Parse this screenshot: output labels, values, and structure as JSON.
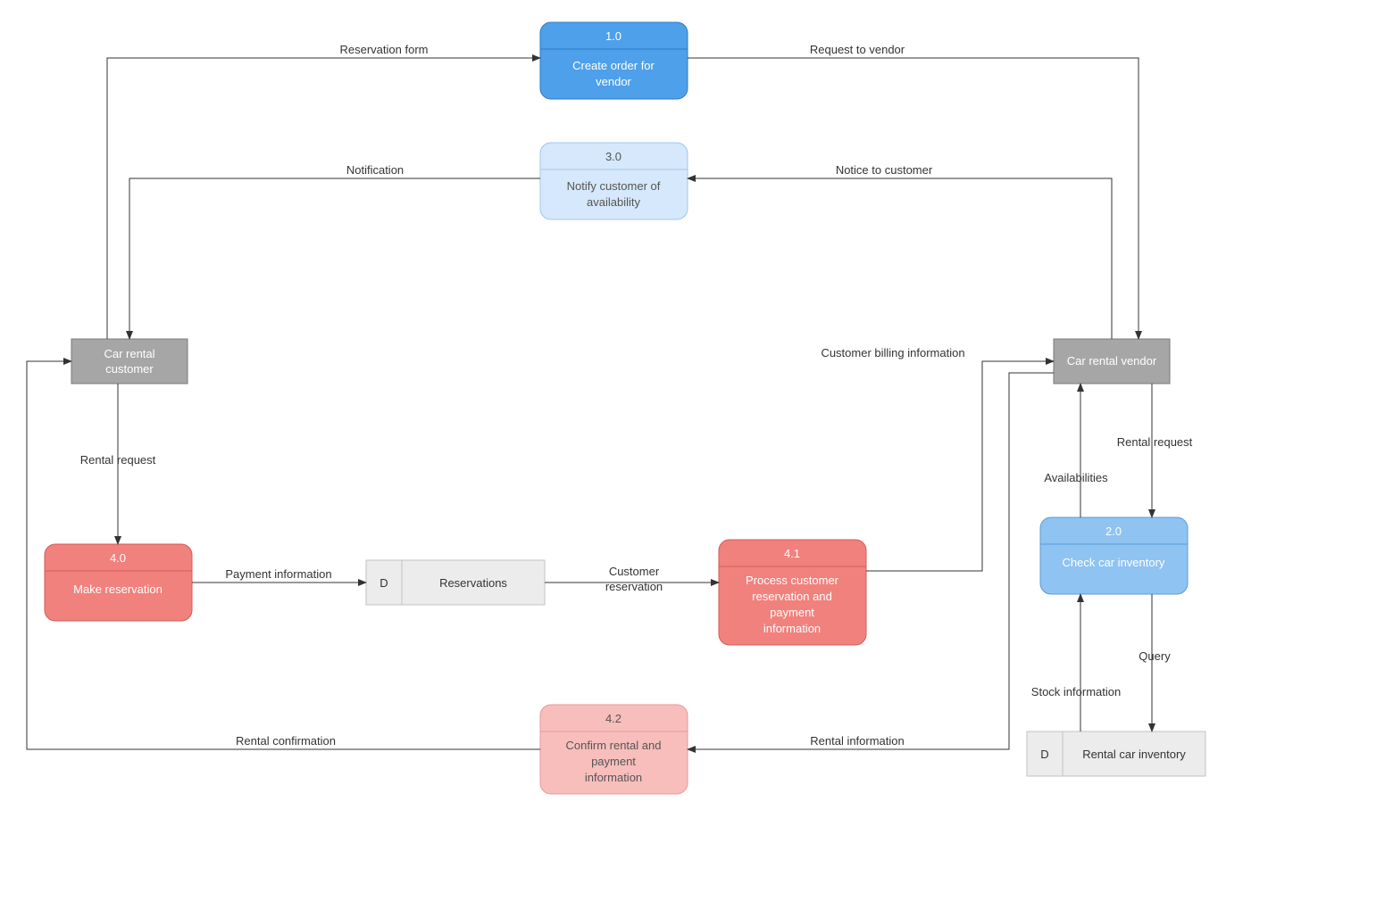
{
  "processes": {
    "p1_0": {
      "num": "1.0",
      "label1": "Create order for",
      "label2": "vendor"
    },
    "p3_0": {
      "num": "3.0",
      "label1": "Notify customer of",
      "label2": "availability"
    },
    "p2_0": {
      "num": "2.0",
      "label1": "Check car inventory",
      "label2": ""
    },
    "p4_0": {
      "num": "4.0",
      "label1": "Make reservation",
      "label2": ""
    },
    "p4_1": {
      "num": "4.1",
      "label1": "Process customer",
      "label2": "reservation and",
      "label3": "payment",
      "label4": "information"
    },
    "p4_2": {
      "num": "4.2",
      "label1": "Confirm rental and",
      "label2": "payment",
      "label3": "information"
    }
  },
  "entities": {
    "customer": {
      "label1": "Car rental",
      "label2": "customer"
    },
    "vendor": {
      "label1": "Car rental vendor",
      "label2": ""
    }
  },
  "datastores": {
    "reservations": {
      "tag": "D",
      "label": "Reservations"
    },
    "inventory": {
      "tag": "D",
      "label": "Rental car inventory"
    }
  },
  "flows": {
    "reservation_form": "Reservation form",
    "request_to_vendor": "Request to vendor",
    "notification": "Notification",
    "notice_to_customer": "Notice to customer",
    "rental_request_left": "Rental request",
    "rental_request_right": "Rental request",
    "availabilities": "Availabilities",
    "query": "Query",
    "stock_information": "Stock information",
    "payment_information": "Payment information",
    "customer_reservation1": "Customer",
    "customer_reservation2": "reservation",
    "customer_billing": "Customer billing information",
    "rental_information": "Rental information",
    "rental_confirmation": "Rental confirmation"
  },
  "colors": {
    "blue_dark_fill": "#4ea0ea",
    "blue_dark_stroke": "#2a7bc4",
    "blue_light_fill": "#d6e8fb",
    "blue_light_stroke": "#9dc7ef",
    "blue_med_fill": "#8fc3f1",
    "blue_med_stroke": "#5a9bd8",
    "red_dark_fill": "#f1817d",
    "red_dark_stroke": "#d65b57",
    "red_med_fill": "#f1817d",
    "red_med_stroke": "#d65b57",
    "red_light_fill": "#f7bebc",
    "red_light_stroke": "#e79a97"
  }
}
